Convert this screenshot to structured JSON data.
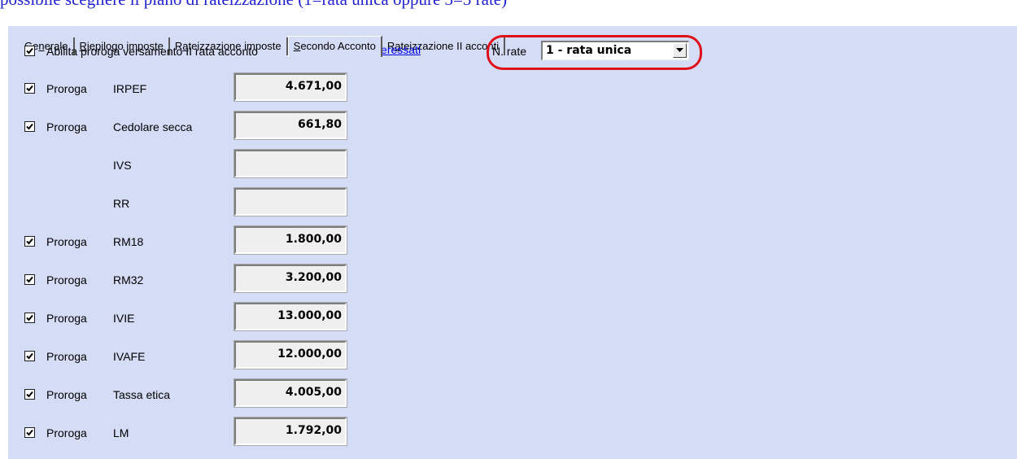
{
  "caption": "possibile scegliere il piano di rateizzazione (1=rata unica oppure 3=3 rate)",
  "tabs": [
    {
      "pre": "Ge",
      "key": "n",
      "post": "erale"
    },
    {
      "pre": "",
      "key": "R",
      "post": "iepilogo imposte"
    },
    {
      "pre": "R",
      "key": "a",
      "post": "teizzazione imposte"
    },
    {
      "pre": "",
      "key": "S",
      "post": "econdo Acconto"
    },
    {
      "pre": "R",
      "key": "a",
      "post": "teizzazione II acconti"
    }
  ],
  "header": {
    "enable_label": "Abilita proroga versamento II rata acconto",
    "enable_checked": true,
    "link_label": "Soggetti interessati",
    "nrate_label": "N. rate",
    "nrate_value": "1 - rata unica"
  },
  "proroga_label": "Proroga",
  "rows": [
    {
      "name": "IRPEF",
      "checked": true,
      "value": "4.671,00"
    },
    {
      "name": "Cedolare secca",
      "checked": true,
      "value": "661,80"
    },
    {
      "name": "IVS",
      "checked": null,
      "value": ""
    },
    {
      "name": "RR",
      "checked": null,
      "value": ""
    },
    {
      "name": "RM18",
      "checked": true,
      "value": "1.800,00"
    },
    {
      "name": "RM32",
      "checked": true,
      "value": "3.200,00"
    },
    {
      "name": "IVIE",
      "checked": true,
      "value": "13.000,00"
    },
    {
      "name": "IVAFE",
      "checked": true,
      "value": "12.000,00"
    },
    {
      "name": "Tassa etica",
      "checked": true,
      "value": "4.005,00"
    },
    {
      "name": "LM",
      "checked": true,
      "value": "1.792,00"
    }
  ]
}
